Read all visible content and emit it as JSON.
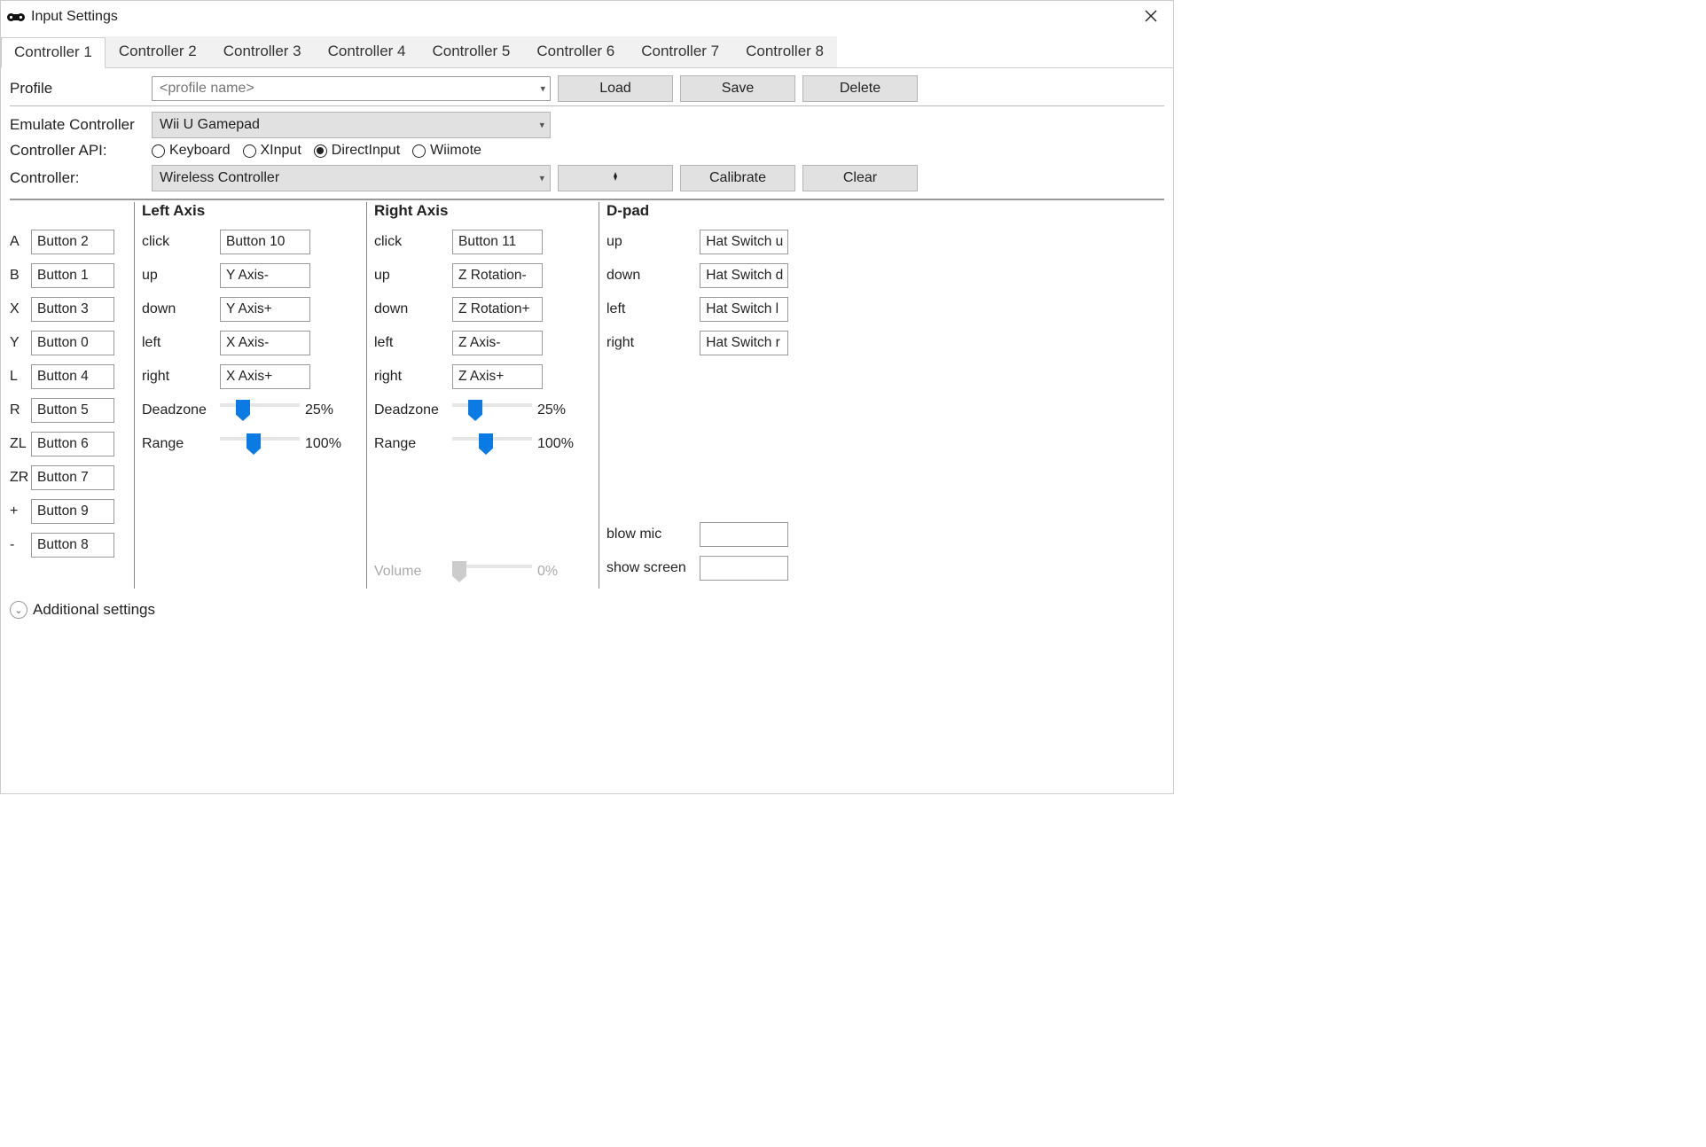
{
  "titlebar": {
    "title": "Input Settings"
  },
  "tabs": [
    "Controller 1",
    "Controller 2",
    "Controller 3",
    "Controller 4",
    "Controller 5",
    "Controller 6",
    "Controller 7",
    "Controller 8"
  ],
  "active_tab": 0,
  "profile": {
    "label": "Profile",
    "placeholder": "<profile name>",
    "load": "Load",
    "save": "Save",
    "delete": "Delete"
  },
  "emulate": {
    "label": "Emulate Controller",
    "value": "Wii U Gamepad"
  },
  "api": {
    "label": "Controller API:",
    "options": [
      "Keyboard",
      "XInput",
      "DirectInput",
      "Wiimote"
    ],
    "selected": "DirectInput"
  },
  "controller": {
    "label": "Controller:",
    "value": "Wireless Controller",
    "calibrate": "Calibrate",
    "clear": "Clear"
  },
  "face_buttons": [
    {
      "label": "A",
      "value": "Button 2"
    },
    {
      "label": "B",
      "value": "Button 1"
    },
    {
      "label": "X",
      "value": "Button 3"
    },
    {
      "label": "Y",
      "value": "Button 0"
    },
    {
      "label": "L",
      "value": "Button 4"
    },
    {
      "label": "R",
      "value": "Button 5"
    },
    {
      "label": "ZL",
      "value": "Button 6"
    },
    {
      "label": "ZR",
      "value": "Button 7"
    },
    {
      "label": "+",
      "value": "Button 9"
    },
    {
      "label": "-",
      "value": "Button 8"
    }
  ],
  "left_axis": {
    "title": "Left Axis",
    "rows": [
      {
        "label": "click",
        "value": "Button 10"
      },
      {
        "label": "up",
        "value": "Y Axis-"
      },
      {
        "label": "down",
        "value": "Y Axis+"
      },
      {
        "label": "left",
        "value": "X Axis-"
      },
      {
        "label": "right",
        "value": "X Axis+"
      }
    ],
    "deadzone": {
      "label": "Deadzone",
      "value": "25%",
      "pos": 18
    },
    "range": {
      "label": "Range",
      "value": "100%",
      "pos": 30
    }
  },
  "right_axis": {
    "title": "Right Axis",
    "rows": [
      {
        "label": "click",
        "value": "Button 11"
      },
      {
        "label": "up",
        "value": "Z Rotation-"
      },
      {
        "label": "down",
        "value": "Z Rotation+"
      },
      {
        "label": "left",
        "value": "Z Axis-"
      },
      {
        "label": "right",
        "value": "Z Axis+"
      }
    ],
    "deadzone": {
      "label": "Deadzone",
      "value": "25%",
      "pos": 18
    },
    "range": {
      "label": "Range",
      "value": "100%",
      "pos": 30
    },
    "volume": {
      "label": "Volume",
      "value": "0%",
      "pos": 0
    }
  },
  "dpad": {
    "title": "D-pad",
    "rows": [
      {
        "label": "up",
        "value": "Hat Switch u"
      },
      {
        "label": "down",
        "value": "Hat Switch d"
      },
      {
        "label": "left",
        "value": "Hat Switch l"
      },
      {
        "label": "right",
        "value": "Hat Switch r"
      }
    ],
    "blow_mic": {
      "label": "blow mic",
      "value": ""
    },
    "show_screen": {
      "label": "show screen",
      "value": ""
    }
  },
  "expander": {
    "label": "Additional settings"
  }
}
